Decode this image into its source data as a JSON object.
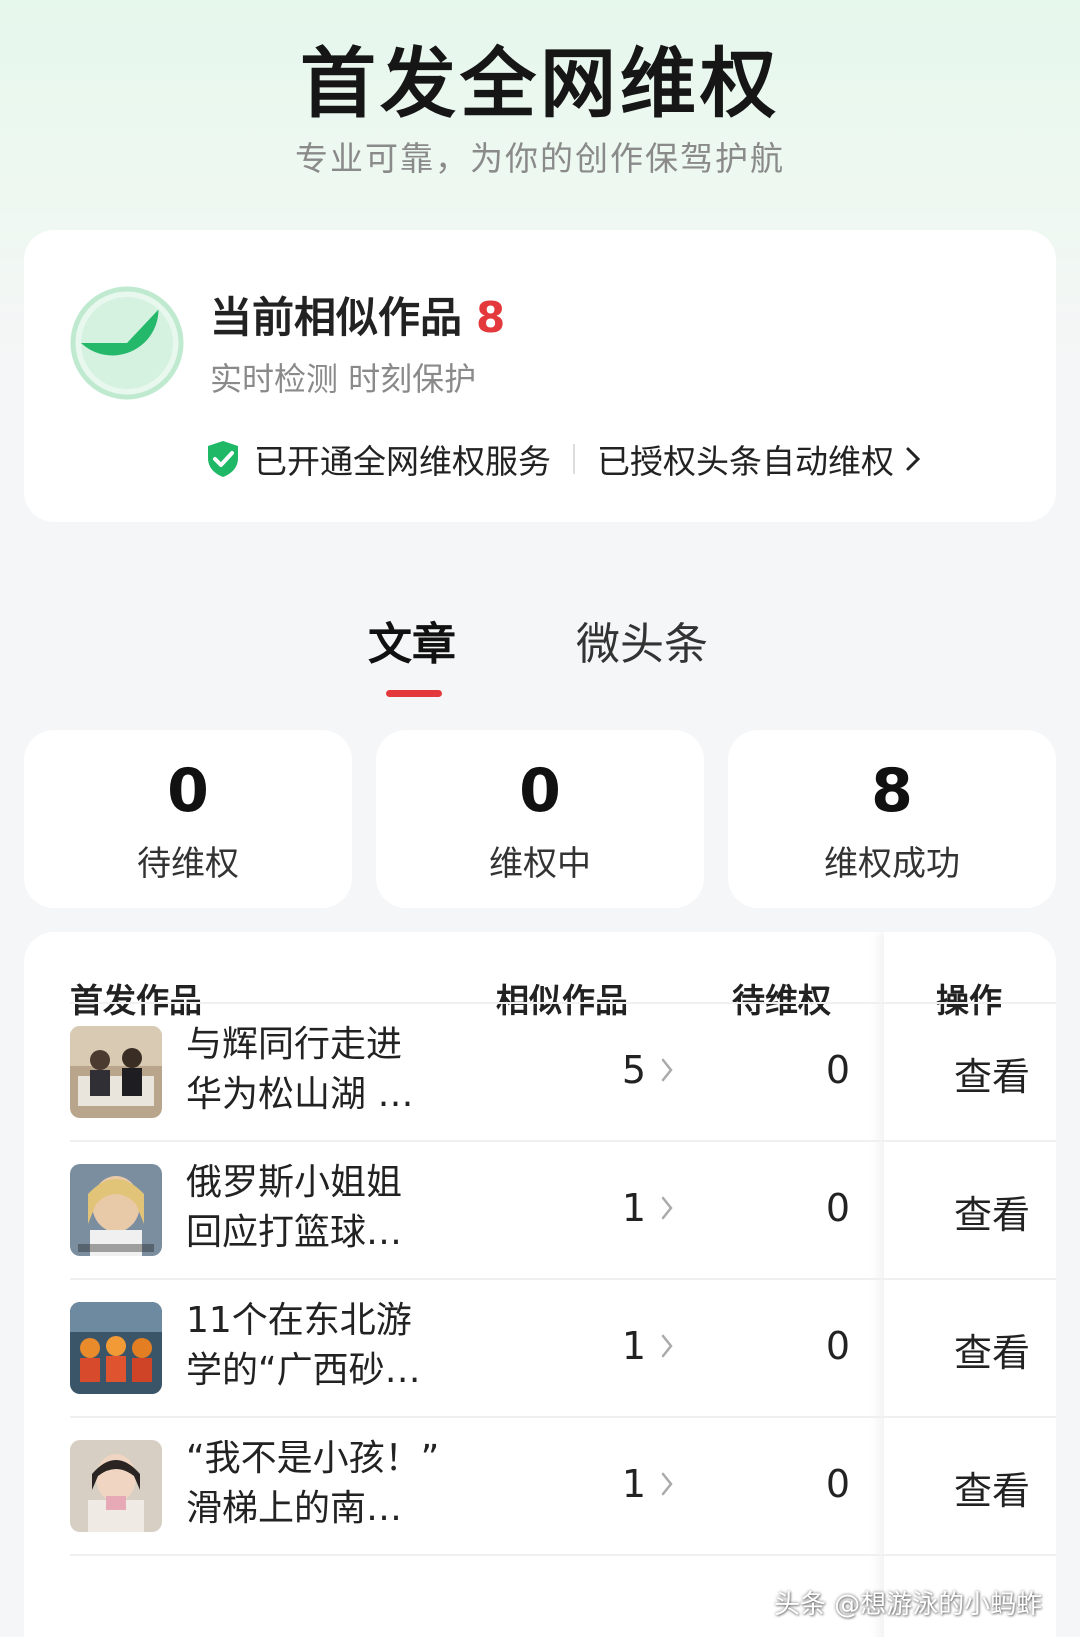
{
  "header": {
    "title": "首发全网维权",
    "subtitle": "专业可靠，为你的创作保驾护航"
  },
  "status": {
    "title": "当前相似作品",
    "count": "8",
    "subtitle": "实时检测 时刻保护",
    "service_label": "已开通全网维权服务",
    "authorize_label": "已授权头条自动维权",
    "ring_fill_fraction": 0.37
  },
  "tabs": [
    {
      "label": "文章",
      "active": true
    },
    {
      "label": "微头条",
      "active": false
    }
  ],
  "stats": [
    {
      "value": "0",
      "label": "待维权"
    },
    {
      "value": "0",
      "label": "维权中"
    },
    {
      "value": "8",
      "label": "维权成功"
    }
  ],
  "table": {
    "headers": {
      "work": "首发作品",
      "similar": "相似作品",
      "pending": "待维权",
      "ops": "操作"
    },
    "rows": [
      {
        "title_line1": "与辉同行走进",
        "title_line2": "华为松山湖 …",
        "similar": "5",
        "pending": "0",
        "action": "查看"
      },
      {
        "title_line1": "俄罗斯小姐姐",
        "title_line2": "回应打篮球…",
        "similar": "1",
        "pending": "0",
        "action": "查看"
      },
      {
        "title_line1": "11个在东北游",
        "title_line2": "学的“广西砂…",
        "similar": "1",
        "pending": "0",
        "action": "查看"
      },
      {
        "title_line1": "“我不是小孩！”",
        "title_line2": "滑梯上的南…",
        "similar": "1",
        "pending": "0",
        "action": "查看"
      }
    ]
  },
  "watermark": "头条 @想游泳的小蚂蚱",
  "colors": {
    "accent_red": "#e4393c",
    "accent_green": "#1fb866"
  }
}
